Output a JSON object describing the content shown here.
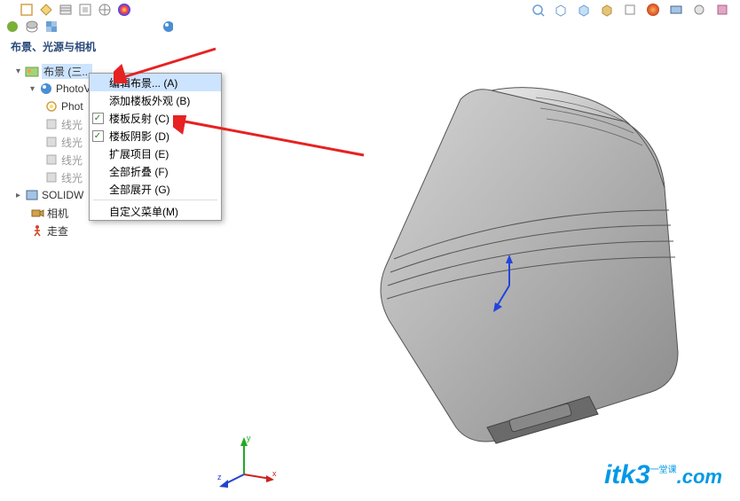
{
  "panel": {
    "title": "布景、光源与相机"
  },
  "tree": {
    "scene": "布景 (三...",
    "photoview": "PhotoV",
    "photo": "Phot",
    "light1": "线光",
    "light2": "线光",
    "light3": "线光",
    "light4": "线光",
    "solidw": "SOLIDW",
    "camera": "相机",
    "walk": "走查"
  },
  "menu": {
    "edit_scene": "编辑布景... (A)",
    "add_floor": "添加楼板外观 (B)",
    "floor_reflect": "楼板反射 (C)",
    "floor_shadow": "楼板阴影 (D)",
    "expand_item": "扩展项目 (E)",
    "collapse_all": "全部折叠 (F)",
    "expand_all": "全部展开 (G)",
    "custom_menu": "自定义菜单(M)"
  },
  "axis": {
    "x": "x",
    "y": "y",
    "z": "z"
  },
  "watermark": {
    "brand": "itk3",
    "sub": "一堂课",
    "com": ".com"
  }
}
